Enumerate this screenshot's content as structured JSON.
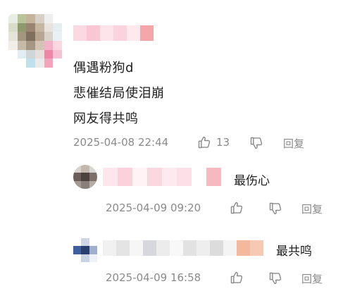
{
  "comment": {
    "username": "",
    "lines": [
      "偶遇粉狗d",
      "悲催结局使泪崩",
      "网友得共鸣"
    ],
    "timestamp": "2025-04-08 22:44",
    "like_count": "13",
    "reply_label": "回复"
  },
  "replies": [
    {
      "username": "",
      "text": "最伤心",
      "timestamp": "2025-04-09 09:20",
      "reply_label": "回复"
    },
    {
      "username": "",
      "text": "最共鸣",
      "timestamp": "2025-04-09 16:58",
      "reply_label": "回复"
    }
  ],
  "icons": {
    "like": "thumbs-up-icon",
    "dislike": "thumbs-down-icon"
  },
  "colors": {
    "meta_text": "#8a8a8a",
    "body_text": "#1f1f1f",
    "blur_pink": "#f7b8c4"
  }
}
